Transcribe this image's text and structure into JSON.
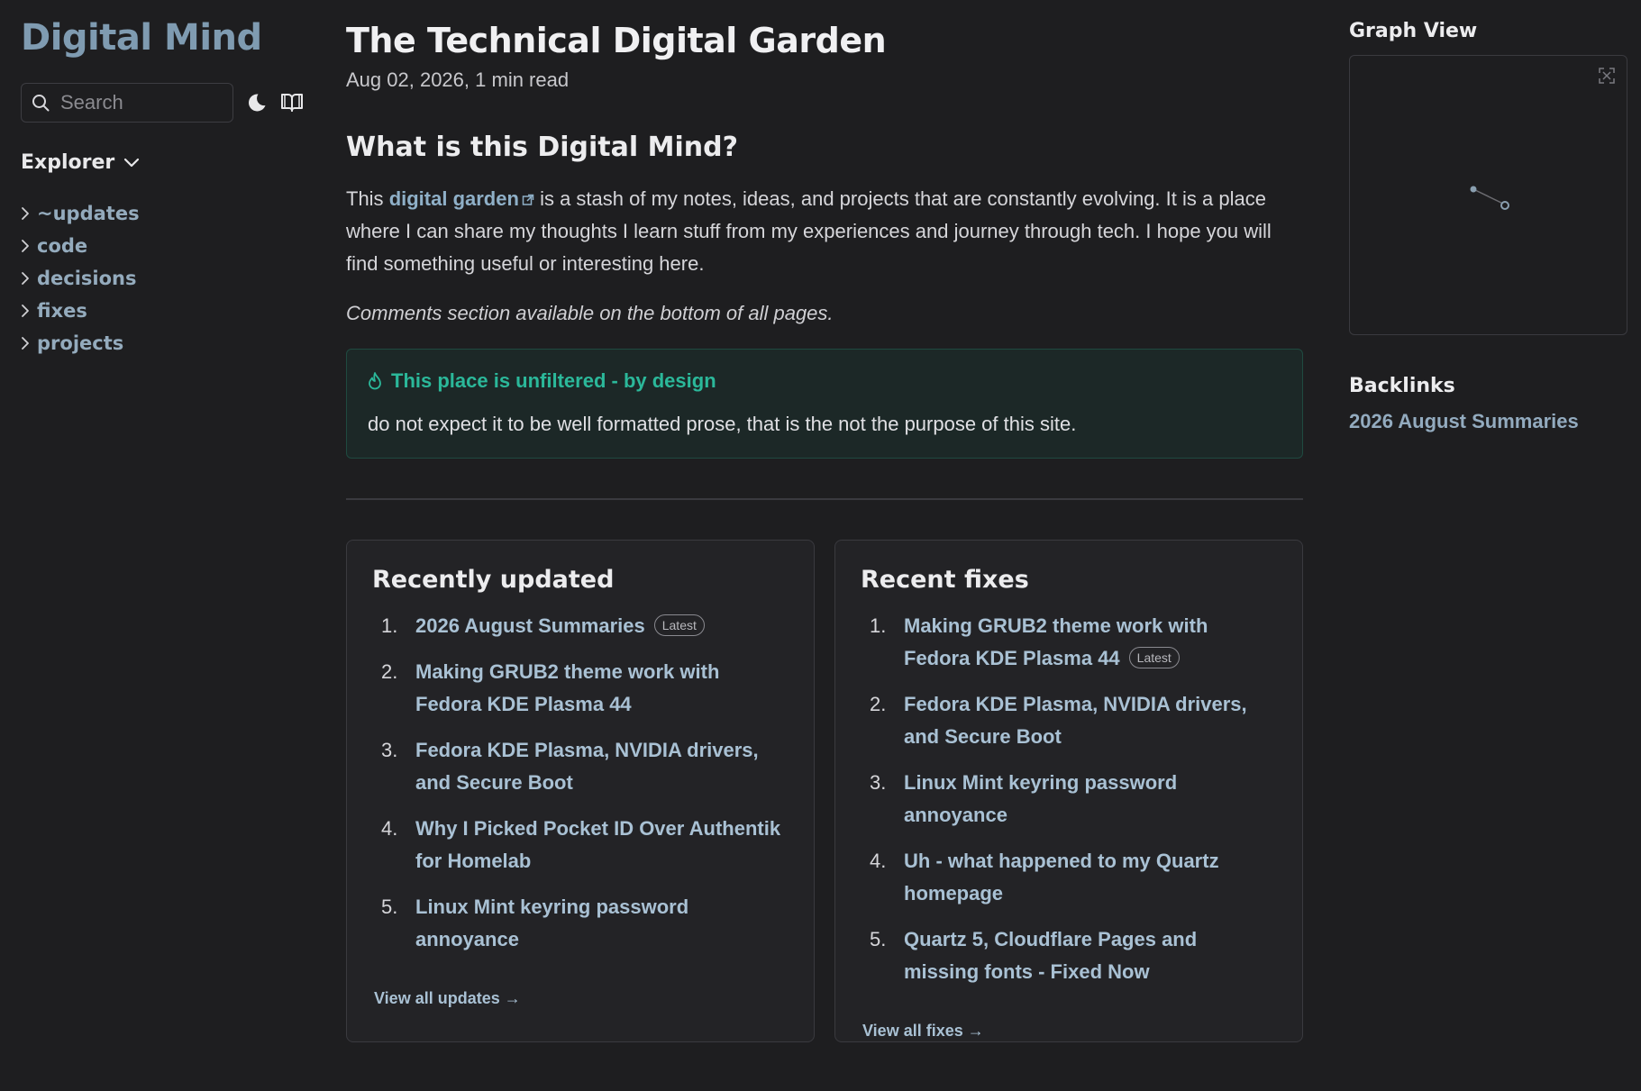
{
  "site": {
    "title": "Digital Mind"
  },
  "search": {
    "placeholder": "Search"
  },
  "explorer": {
    "title": "Explorer",
    "items": [
      "~updates",
      "code",
      "decisions",
      "fixes",
      "projects"
    ]
  },
  "page": {
    "title": "The Technical Digital Garden",
    "date": "Aug 02, 2026,",
    "read_time": "1 min read",
    "section_heading": "What is this Digital Mind?",
    "intro_prefix": "This",
    "intro_link": "digital garden",
    "intro_rest": "is a stash of my notes, ideas, and projects that are constantly evolving. It is a place where I can share my thoughts I learn stuff from my experiences and journey through tech. I hope you will find something useful or interesting here.",
    "comments_note": "Comments section available on the bottom of all pages."
  },
  "callout": {
    "title": "This place is unfiltered - by design",
    "body": "do not expect it to be well formatted prose, that is the not the purpose of this site."
  },
  "recently_updated": {
    "title": "Recently updated",
    "items": [
      {
        "label": "2026 August Summaries",
        "badge": "Latest"
      },
      {
        "label": "Making GRUB2 theme work with Fedora KDE Plasma 44"
      },
      {
        "label": "Fedora KDE Plasma, NVIDIA drivers, and Secure Boot"
      },
      {
        "label": "Why I Picked Pocket ID Over Authentik for Homelab"
      },
      {
        "label": "Linux Mint keyring password annoyance"
      }
    ],
    "view_all": "View all updates →"
  },
  "recent_fixes": {
    "title": "Recent fixes",
    "items": [
      {
        "label": "Making GRUB2 theme work with Fedora KDE Plasma 44",
        "badge": "Latest"
      },
      {
        "label": "Fedora KDE Plasma, NVIDIA drivers, and Secure Boot"
      },
      {
        "label": "Linux Mint keyring password annoyance"
      },
      {
        "label": "Uh - what happened to my Quartz homepage"
      },
      {
        "label": "Quartz 5, Cloudflare Pages and missing fonts - Fixed Now"
      }
    ],
    "view_all": "View all fixes →"
  },
  "graph": {
    "title": "Graph View"
  },
  "backlinks": {
    "title": "Backlinks",
    "items": [
      "2026 August Summaries"
    ]
  },
  "colors": {
    "background": "#1e1e20",
    "accent": "#7f9bb1",
    "link": "#a9c1d4",
    "callout_accent": "#2bb89a"
  },
  "icons": {
    "search": "search-icon",
    "theme": "moon-icon",
    "reader": "book-icon",
    "chevron": "chevron-right-icon",
    "flame": "flame-icon",
    "external": "external-link-icon",
    "expand": "expand-icon"
  }
}
